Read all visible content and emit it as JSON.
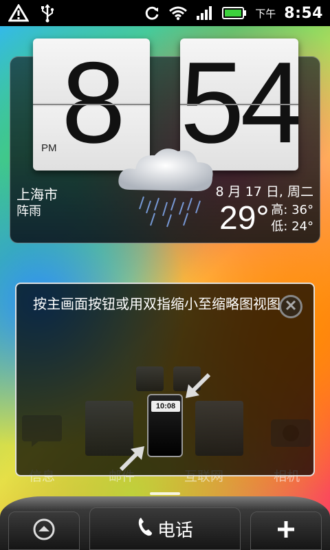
{
  "status_bar": {
    "period": "下午",
    "time": "8:54",
    "icons": [
      "warning-icon",
      "usb-icon",
      "sync-icon",
      "wifi-icon",
      "signal-icon",
      "battery-icon"
    ]
  },
  "clock_widget": {
    "hours": "8",
    "minutes": "54",
    "ampm": "PM",
    "city": "上海市",
    "weather": "阵雨",
    "date": "8 月 17 日, 周二",
    "temperature": "29°",
    "high": "高: 36°",
    "low": "低: 24°",
    "weather_icon": "rain-cloud-icon"
  },
  "hint_card": {
    "text": "按主画面按钮或用双指缩小至缩略图视图",
    "mini_clock": "10:08"
  },
  "dock_labels": [
    "信息",
    "邮件",
    "互联网",
    "相机"
  ],
  "bottom_bar": {
    "phone_label": "电话"
  }
}
